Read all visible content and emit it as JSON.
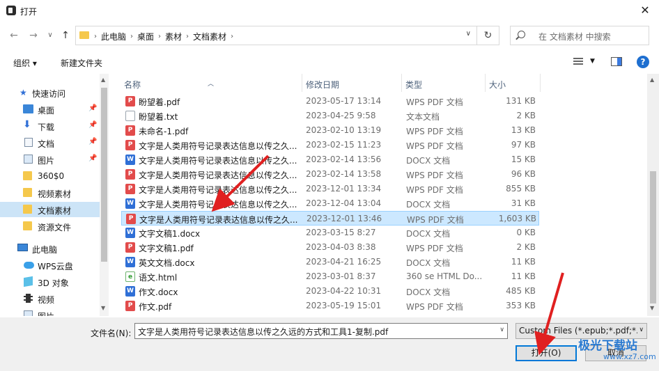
{
  "window": {
    "title": "打开",
    "close_label": "✕"
  },
  "nav": {
    "back": "←",
    "forward": "→",
    "recent": "∨",
    "up": "↑",
    "breadcrumbs": [
      "此电脑",
      "桌面",
      "素材",
      "文档素材"
    ],
    "refresh": "↻",
    "search_placeholder": "在 文档素材 中搜索"
  },
  "toolbar": {
    "organize": "组织 ▾",
    "new_folder": "新建文件夹",
    "help": "?"
  },
  "sidebar": {
    "items": [
      {
        "label": "快速访问",
        "icon": "star-icon"
      },
      {
        "label": "桌面",
        "icon": "desktop-icon",
        "pinned": true
      },
      {
        "label": "下载",
        "icon": "download-icon",
        "pinned": true
      },
      {
        "label": "文档",
        "icon": "document-icon",
        "pinned": true
      },
      {
        "label": "图片",
        "icon": "picture-icon",
        "pinned": true
      },
      {
        "label": "360$0",
        "icon": "folder-icon"
      },
      {
        "label": "视频素材",
        "icon": "folder-icon"
      },
      {
        "label": "文档素材",
        "icon": "folder-icon",
        "selected": true
      },
      {
        "label": "资源文件",
        "icon": "folder-icon"
      },
      {
        "label": "此电脑",
        "icon": "computer-icon"
      },
      {
        "label": "WPS云盘",
        "icon": "cloud-icon"
      },
      {
        "label": "3D 对象",
        "icon": "3d-icon"
      },
      {
        "label": "视频",
        "icon": "video-icon"
      },
      {
        "label": "图片",
        "icon": "picture-icon"
      }
    ]
  },
  "columns": {
    "name": "名称",
    "date": "修改日期",
    "type": "类型",
    "size": "大小"
  },
  "files": [
    {
      "name": "盼望着.pdf",
      "date": "2023-05-17 13:14",
      "type": "WPS PDF 文档",
      "size": "131 KB",
      "kind": "pdf"
    },
    {
      "name": "盼望着.txt",
      "date": "2023-04-25 9:58",
      "type": "文本文档",
      "size": "2 KB",
      "kind": "txt"
    },
    {
      "name": "未命名-1.pdf",
      "date": "2023-02-10 13:19",
      "type": "WPS PDF 文档",
      "size": "13 KB",
      "kind": "pdf"
    },
    {
      "name": "文字是人类用符号记录表达信息以传之久...",
      "date": "2023-02-15 11:23",
      "type": "WPS PDF 文档",
      "size": "97 KB",
      "kind": "pdf"
    },
    {
      "name": "文字是人类用符号记录表达信息以传之久...",
      "date": "2023-02-14 13:56",
      "type": "DOCX 文档",
      "size": "15 KB",
      "kind": "doc"
    },
    {
      "name": "文字是人类用符号记录表达信息以传之久...",
      "date": "2023-02-14 13:58",
      "type": "WPS PDF 文档",
      "size": "96 KB",
      "kind": "pdf"
    },
    {
      "name": "文字是人类用符号记录表达信息以传之久...",
      "date": "2023-12-01 13:34",
      "type": "WPS PDF 文档",
      "size": "855 KB",
      "kind": "pdf"
    },
    {
      "name": "文字是人类用符号记录表达信息以传之久...",
      "date": "2023-12-04 13:04",
      "type": "DOCX 文档",
      "size": "31 KB",
      "kind": "doc"
    },
    {
      "name": "文字是人类用符号记录表达信息以传之久...",
      "date": "2023-12-01 13:46",
      "type": "WPS PDF 文档",
      "size": "1,603 KB",
      "kind": "pdf",
      "selected": true
    },
    {
      "name": "文字文稿1.docx",
      "date": "2023-03-15 8:27",
      "type": "DOCX 文档",
      "size": "0 KB",
      "kind": "doc"
    },
    {
      "name": "文字文稿1.pdf",
      "date": "2023-04-03 8:38",
      "type": "WPS PDF 文档",
      "size": "2 KB",
      "kind": "pdf"
    },
    {
      "name": "英文文档.docx",
      "date": "2023-04-21 16:25",
      "type": "DOCX 文档",
      "size": "11 KB",
      "kind": "doc"
    },
    {
      "name": "语文.html",
      "date": "2023-03-01 8:37",
      "type": "360 se HTML Do...",
      "size": "11 KB",
      "kind": "html"
    },
    {
      "name": "作文.docx",
      "date": "2023-04-22 10:31",
      "type": "DOCX 文档",
      "size": "485 KB",
      "kind": "doc"
    },
    {
      "name": "作文.pdf",
      "date": "2023-05-19 15:01",
      "type": "WPS PDF 文档",
      "size": "353 KB",
      "kind": "pdf"
    }
  ],
  "bottom": {
    "filename_label": "文件名(N):",
    "filename_value": "文字是人类用符号记录表达信息以传之久远的方式和工具1-复制.pdf",
    "filter_value": "Custom Files (*.epub;*.pdf;*.t",
    "open_label": "打开(O)",
    "cancel_label": "取消"
  },
  "watermark": {
    "text": "极光下载站",
    "url": "www.xz7.com"
  },
  "colors": {
    "accent": "#0078d7",
    "selection": "#cce8ff",
    "annotation_arrow": "#e02020"
  }
}
